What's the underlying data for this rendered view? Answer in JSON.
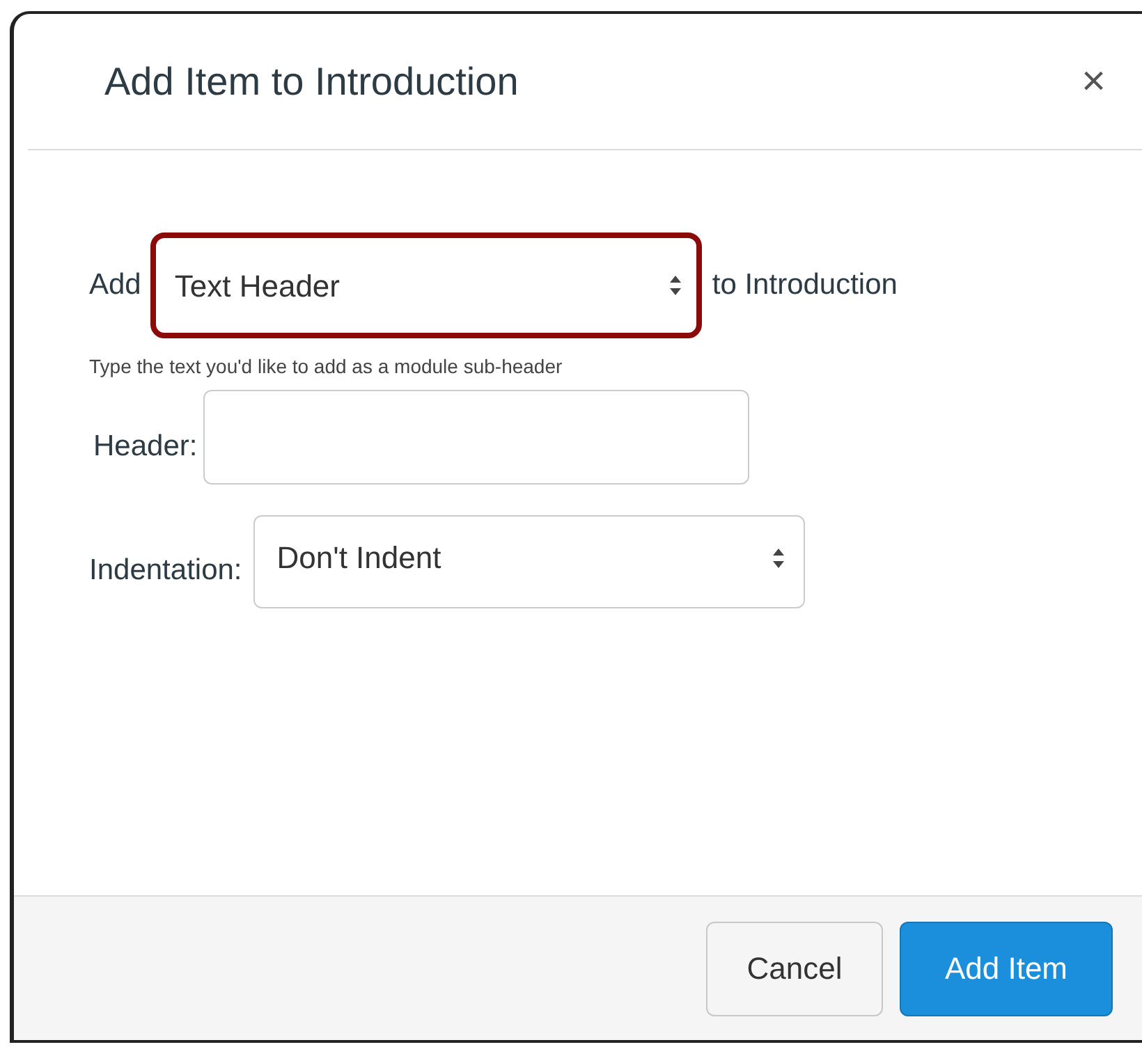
{
  "dialog": {
    "title": "Add Item to Introduction",
    "close": "×"
  },
  "add_row": {
    "prefix": "Add",
    "select": {
      "value": "Text Header",
      "highlighted": true
    },
    "suffix": "to Introduction"
  },
  "hint": "Type the text you'd like to add as a module sub-header",
  "header_field": {
    "label": "Header:"
  },
  "indentation": {
    "label": "Indentation:",
    "value": "Don't Indent"
  },
  "buttons": [
    {
      "label": "Cancel",
      "kind": "secondary"
    },
    {
      "label": "Add Item",
      "kind": "primary"
    }
  ]
}
